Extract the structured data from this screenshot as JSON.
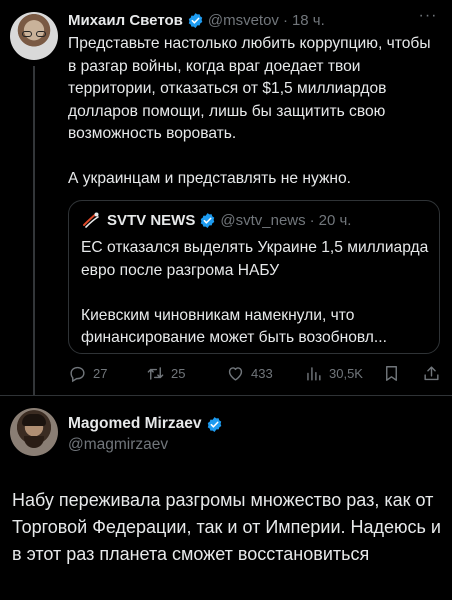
{
  "tweet": {
    "author_name": "Михаил Светов",
    "handle": "@msvetov",
    "separator": "·",
    "time": "18 ч.",
    "more_label": "···",
    "paragraphs": [
      "Представьте настолько любить коррупцию, чтобы в разгар войны, когда враг доедает твои территории, отказаться от $1,5 миллиардов долларов помощи, лишь бы защитить свою возможность воровать.",
      "А украинцам и представлять не нужно."
    ],
    "quote": {
      "author_name": "SVTV NEWS",
      "handle": "@svtv_news",
      "separator": "·",
      "time": "20 ч.",
      "paragraphs": [
        "ЕС отказался выделять Украине 1,5 миллиарда евро после разгрома НАБУ",
        "Киевским чиновникам намекнули, что финансирование может быть возобновл..."
      ]
    },
    "actions": {
      "replies": "27",
      "retweets": "25",
      "likes": "433",
      "views": "30,5K"
    }
  },
  "reply": {
    "author_name": "Magomed Mirzaev",
    "handle": "@magmirzaev",
    "text": "Набу переживала разгромы множество раз, как от Торговой Федерации, так и от Империи. Надеюсь и в этот раз планета сможет восстановиться"
  },
  "colors": {
    "background": "#000000",
    "text": "#e7e9ea",
    "secondary": "#71767b",
    "verified_blue": "#1d9bf0",
    "border": "#2f3336"
  },
  "icons": [
    "verified-badge-icon",
    "more-icon",
    "reply-icon",
    "retweet-icon",
    "like-icon",
    "views-icon",
    "bookmark-icon",
    "share-icon",
    "satellite-logo-icon"
  ]
}
